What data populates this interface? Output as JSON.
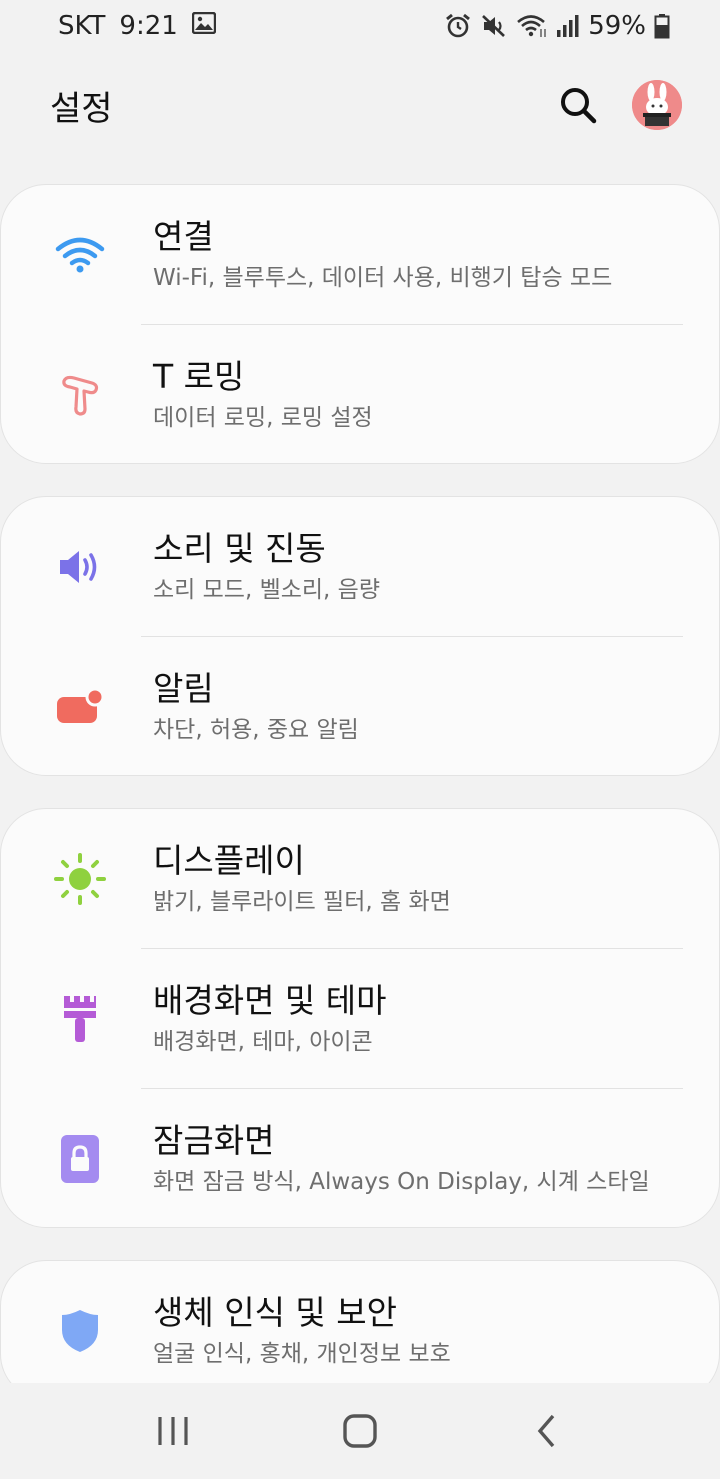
{
  "status_bar": {
    "carrier": "SKT",
    "time": "9:21",
    "battery": "59%",
    "icons": [
      "image-icon",
      "alarm-icon",
      "mute-icon",
      "wifi-icon",
      "signal-icon",
      "battery-icon"
    ]
  },
  "header": {
    "title": "설정",
    "search_icon": "search-icon",
    "avatar_icon": "bunny-avatar"
  },
  "groups": [
    {
      "items": [
        {
          "title": "연결",
          "subtitle": "Wi-Fi, 블루투스, 데이터 사용, 비행기 탑승 모드",
          "icon": "wifi-icon",
          "color": "#3d9af0"
        },
        {
          "title": "T 로밍",
          "subtitle": "데이터 로밍, 로밍 설정",
          "icon": "t-roaming-icon",
          "color": "#ef8b8b"
        }
      ]
    },
    {
      "items": [
        {
          "title": "소리 및 진동",
          "subtitle": "소리 모드, 벨소리, 음량",
          "icon": "speaker-icon",
          "color": "#7b72e8"
        },
        {
          "title": "알림",
          "subtitle": "차단, 허용, 중요 알림",
          "icon": "notification-icon",
          "color": "#f06b5f"
        }
      ]
    },
    {
      "items": [
        {
          "title": "디스플레이",
          "subtitle": "밝기, 블루라이트 필터, 홈 화면",
          "icon": "sun-icon",
          "color": "#8fd13f"
        },
        {
          "title": "배경화면 및 테마",
          "subtitle": "배경화면, 테마, 아이콘",
          "icon": "paintbrush-icon",
          "color": "#b45bd6"
        },
        {
          "title": "잠금화면",
          "subtitle": "화면 잠금 방식, Always On Display, 시계 스타일",
          "icon": "lock-icon",
          "color": "#a48bf0"
        }
      ]
    },
    {
      "items": [
        {
          "title": "생체 인식 및 보안",
          "subtitle": "얼굴 인식, 홍채, 개인정보 보호",
          "icon": "shield-icon",
          "color": "#7fa8f5"
        }
      ]
    }
  ],
  "nav_bar": {
    "recents_icon": "recents-icon",
    "home_icon": "home-icon",
    "back_icon": "back-icon"
  }
}
